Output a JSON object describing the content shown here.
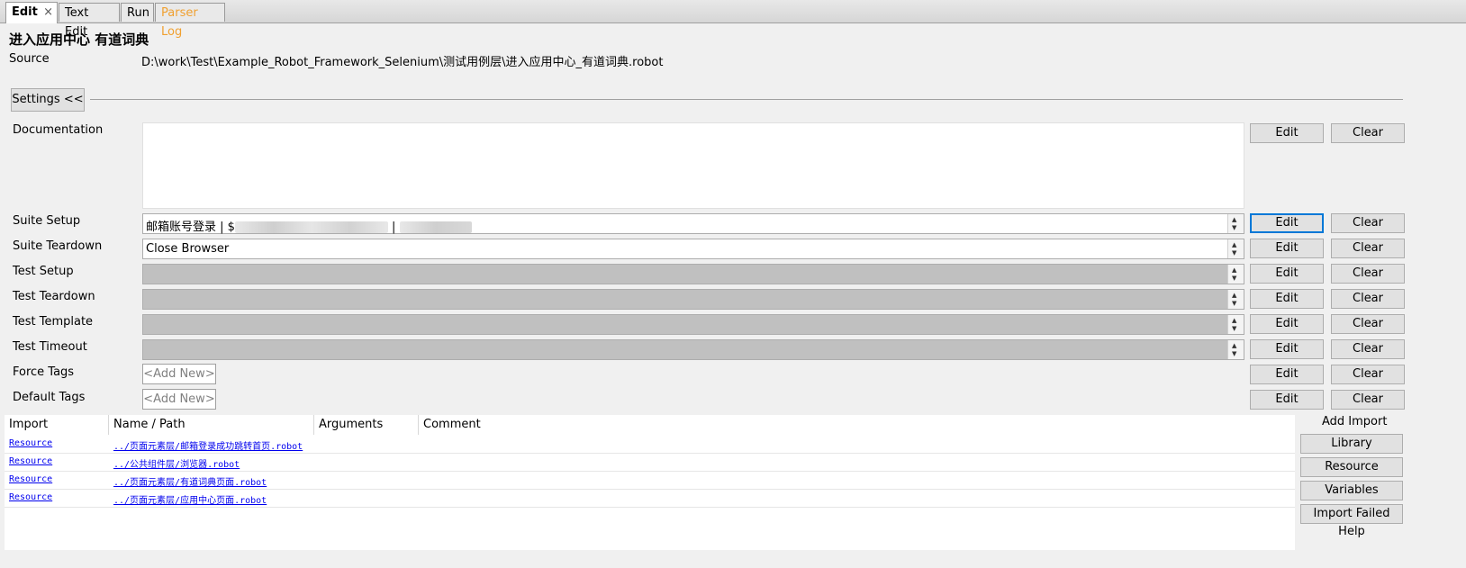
{
  "tabs": [
    {
      "label": "Edit",
      "close": "×",
      "active": true
    },
    {
      "label": "Text Edit",
      "active": false
    },
    {
      "label": "Run",
      "active": false
    },
    {
      "label": "Parser Log",
      "active": false,
      "color": "#f0a030"
    }
  ],
  "title": "进入应用中心 有道词典",
  "source": {
    "label": "Source",
    "value": "D:\\work\\Test\\Example_Robot_Framework_Selenium\\测试用例层\\进入应用中心_有道词典.robot"
  },
  "settings_button": "Settings <<",
  "settings": {
    "documentation": {
      "label": "Documentation",
      "value": ""
    },
    "suite_setup": {
      "label": "Suite Setup",
      "prefix": "邮箱账号登录 | $",
      "sep": " | "
    },
    "suite_teardown": {
      "label": "Suite Teardown",
      "value": "Close Browser"
    },
    "test_setup": {
      "label": "Test Setup"
    },
    "test_teardown": {
      "label": "Test Teardown"
    },
    "test_template": {
      "label": "Test Template"
    },
    "test_timeout": {
      "label": "Test Timeout"
    },
    "force_tags": {
      "label": "Force Tags",
      "placeholder": "<Add New>"
    },
    "default_tags": {
      "label": "Default Tags",
      "placeholder": "<Add New>"
    }
  },
  "buttons": {
    "edit": "Edit",
    "clear": "Clear"
  },
  "imports": {
    "headers": [
      "Import",
      "Name / Path",
      "Arguments",
      "Comment"
    ],
    "rows": [
      {
        "type": "Resource",
        "path": "../页面元素层/邮箱登录成功跳转首页.robot"
      },
      {
        "type": "Resource",
        "path": "../公共组件层/浏览器.robot"
      },
      {
        "type": "Resource",
        "path": "../页面元素层/有道词典页面.robot"
      },
      {
        "type": "Resource",
        "path": "../页面元素层/应用中心页面.robot"
      }
    ]
  },
  "add_import": {
    "label": "Add Import",
    "buttons": [
      "Library",
      "Resource",
      "Variables",
      "Import Failed Help"
    ]
  }
}
